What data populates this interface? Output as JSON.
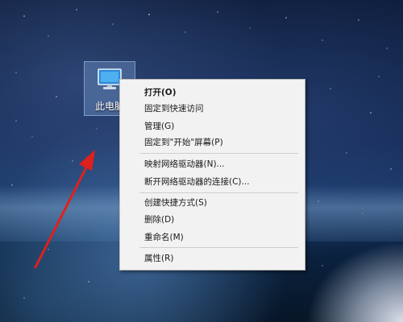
{
  "desktop": {
    "icon": {
      "label": "此电脑",
      "icon_name": "computer-icon"
    }
  },
  "context_menu": {
    "items": [
      {
        "label": "打开(O)",
        "bold": true
      },
      {
        "label": "固定到快速访问"
      },
      {
        "label": "管理(G)"
      },
      {
        "label": "固定到\"开始\"屏幕(P)"
      },
      {
        "label": "映射网络驱动器(N)..."
      },
      {
        "label": "断开网络驱动器的连接(C)..."
      },
      {
        "label": "创建快捷方式(S)"
      },
      {
        "label": "删除(D)"
      },
      {
        "label": "重命名(M)"
      },
      {
        "label": "属性(R)"
      }
    ]
  },
  "annotation": {
    "arrow_color": "#e0201c"
  },
  "colors": {
    "menu_bg": "#f2f2f2",
    "menu_border": "#b9b9b9",
    "separator": "#cfcfcf"
  }
}
